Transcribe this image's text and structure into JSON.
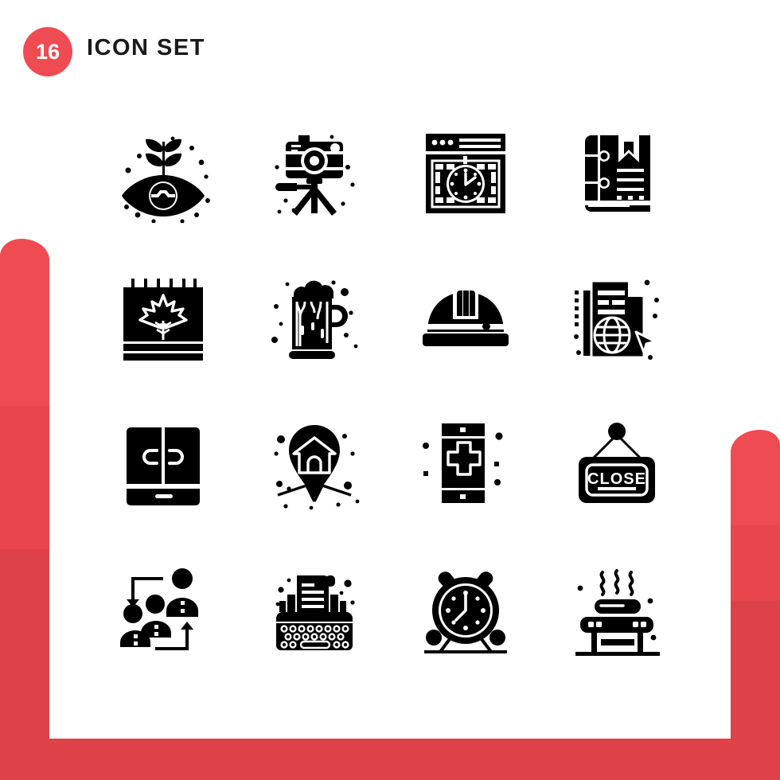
{
  "meta": {
    "badge_count": "16",
    "title": "ICON SET",
    "accent_color": "#ef4b53",
    "accent_dark": "#de4148",
    "accent_mid": "#e8454c",
    "icon_color": "#000000",
    "background": "#ffffff",
    "grid_columns": 4,
    "grid_rows": 4
  },
  "icons": [
    {
      "index": 1,
      "name": "eye-plant-icon",
      "label": "Eye with sprout"
    },
    {
      "index": 2,
      "name": "camera-tripod-icon",
      "label": "Camera on tripod"
    },
    {
      "index": 3,
      "name": "browser-clock-icon",
      "label": "Browser window with clock"
    },
    {
      "index": 4,
      "name": "book-bookmark-icon",
      "label": "Book with bookmark"
    },
    {
      "index": 5,
      "name": "calendar-maple-leaf-icon",
      "label": "Calendar with maple leaf"
    },
    {
      "index": 6,
      "name": "beer-mug-icon",
      "label": "Beer mug with foam"
    },
    {
      "index": 7,
      "name": "hard-hat-icon",
      "label": "Safety hard hat"
    },
    {
      "index": 8,
      "name": "document-globe-icon",
      "label": "Document with globe and cursor"
    },
    {
      "index": 9,
      "name": "wardrobe-icon",
      "label": "Wardrobe cabinet"
    },
    {
      "index": 10,
      "name": "map-pin-house-icon",
      "label": "Location pin with house"
    },
    {
      "index": 11,
      "name": "mobile-medical-icon",
      "label": "Mobile phone with medical cross"
    },
    {
      "index": 12,
      "name": "close-sign-icon",
      "label": "Hanging CLOSE sign"
    },
    {
      "index": 13,
      "name": "team-hierarchy-icon",
      "label": "Team users with arrows"
    },
    {
      "index": 14,
      "name": "typewriter-icon",
      "label": "Typewriter"
    },
    {
      "index": 15,
      "name": "alarm-clock-icon",
      "label": "Alarm clock"
    },
    {
      "index": 16,
      "name": "bbq-grill-icon",
      "label": "BBQ grill with hot dog"
    }
  ],
  "icon_text": {
    "close_sign": "CLOSE"
  }
}
